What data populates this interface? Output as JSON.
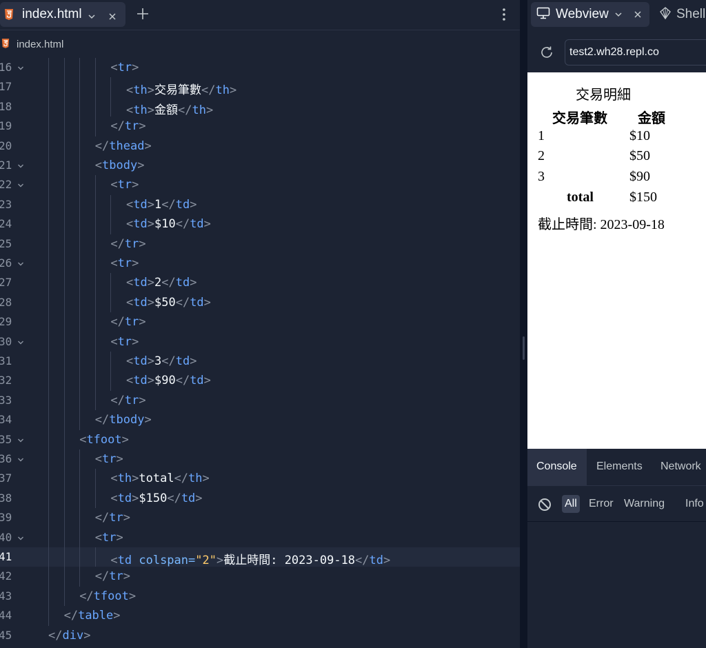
{
  "editor": {
    "tab_label": "index.html",
    "breadcrumb": "index.html",
    "active_line": "41",
    "lines": [
      {
        "n": "16",
        "fold": true,
        "indent": 5,
        "parts": [
          [
            "p",
            "<"
          ],
          [
            "tg",
            "tr"
          ],
          [
            "p",
            ">"
          ]
        ]
      },
      {
        "n": "17",
        "fold": false,
        "indent": 6,
        "parts": [
          [
            "p",
            "<"
          ],
          [
            "tg",
            "th"
          ],
          [
            "p",
            ">"
          ],
          [
            "t",
            "交易筆數"
          ],
          [
            "p",
            "</"
          ],
          [
            "tg",
            "th"
          ],
          [
            "p",
            ">"
          ]
        ]
      },
      {
        "n": "18",
        "fold": false,
        "indent": 6,
        "parts": [
          [
            "p",
            "<"
          ],
          [
            "tg",
            "th"
          ],
          [
            "p",
            ">"
          ],
          [
            "t",
            "金額"
          ],
          [
            "p",
            "</"
          ],
          [
            "tg",
            "th"
          ],
          [
            "p",
            ">"
          ]
        ]
      },
      {
        "n": "19",
        "fold": false,
        "indent": 5,
        "parts": [
          [
            "p",
            "</"
          ],
          [
            "tg",
            "tr"
          ],
          [
            "p",
            ">"
          ]
        ]
      },
      {
        "n": "20",
        "fold": false,
        "indent": 4,
        "parts": [
          [
            "p",
            "</"
          ],
          [
            "tg",
            "thead"
          ],
          [
            "p",
            ">"
          ]
        ]
      },
      {
        "n": "21",
        "fold": true,
        "indent": 4,
        "parts": [
          [
            "p",
            "<"
          ],
          [
            "tg",
            "tbody"
          ],
          [
            "p",
            ">"
          ]
        ]
      },
      {
        "n": "22",
        "fold": true,
        "indent": 5,
        "parts": [
          [
            "p",
            "<"
          ],
          [
            "tg",
            "tr"
          ],
          [
            "p",
            ">"
          ]
        ]
      },
      {
        "n": "23",
        "fold": false,
        "indent": 6,
        "parts": [
          [
            "p",
            "<"
          ],
          [
            "tg",
            "td"
          ],
          [
            "p",
            ">"
          ],
          [
            "t",
            "1"
          ],
          [
            "p",
            "</"
          ],
          [
            "tg",
            "td"
          ],
          [
            "p",
            ">"
          ]
        ]
      },
      {
        "n": "24",
        "fold": false,
        "indent": 6,
        "parts": [
          [
            "p",
            "<"
          ],
          [
            "tg",
            "td"
          ],
          [
            "p",
            ">"
          ],
          [
            "t",
            "$10"
          ],
          [
            "p",
            "</"
          ],
          [
            "tg",
            "td"
          ],
          [
            "p",
            ">"
          ]
        ]
      },
      {
        "n": "25",
        "fold": false,
        "indent": 5,
        "parts": [
          [
            "p",
            "</"
          ],
          [
            "tg",
            "tr"
          ],
          [
            "p",
            ">"
          ]
        ]
      },
      {
        "n": "26",
        "fold": true,
        "indent": 5,
        "parts": [
          [
            "p",
            "<"
          ],
          [
            "tg",
            "tr"
          ],
          [
            "p",
            ">"
          ]
        ]
      },
      {
        "n": "27",
        "fold": false,
        "indent": 6,
        "parts": [
          [
            "p",
            "<"
          ],
          [
            "tg",
            "td"
          ],
          [
            "p",
            ">"
          ],
          [
            "t",
            "2"
          ],
          [
            "p",
            "</"
          ],
          [
            "tg",
            "td"
          ],
          [
            "p",
            ">"
          ]
        ]
      },
      {
        "n": "28",
        "fold": false,
        "indent": 6,
        "parts": [
          [
            "p",
            "<"
          ],
          [
            "tg",
            "td"
          ],
          [
            "p",
            ">"
          ],
          [
            "t",
            "$50"
          ],
          [
            "p",
            "</"
          ],
          [
            "tg",
            "td"
          ],
          [
            "p",
            ">"
          ]
        ]
      },
      {
        "n": "29",
        "fold": false,
        "indent": 5,
        "parts": [
          [
            "p",
            "</"
          ],
          [
            "tg",
            "tr"
          ],
          [
            "p",
            ">"
          ]
        ]
      },
      {
        "n": "30",
        "fold": true,
        "indent": 5,
        "parts": [
          [
            "p",
            "<"
          ],
          [
            "tg",
            "tr"
          ],
          [
            "p",
            ">"
          ]
        ]
      },
      {
        "n": "31",
        "fold": false,
        "indent": 6,
        "parts": [
          [
            "p",
            "<"
          ],
          [
            "tg",
            "td"
          ],
          [
            "p",
            ">"
          ],
          [
            "t",
            "3"
          ],
          [
            "p",
            "</"
          ],
          [
            "tg",
            "td"
          ],
          [
            "p",
            ">"
          ]
        ]
      },
      {
        "n": "32",
        "fold": false,
        "indent": 6,
        "parts": [
          [
            "p",
            "<"
          ],
          [
            "tg",
            "td"
          ],
          [
            "p",
            ">"
          ],
          [
            "t",
            "$90"
          ],
          [
            "p",
            "</"
          ],
          [
            "tg",
            "td"
          ],
          [
            "p",
            ">"
          ]
        ]
      },
      {
        "n": "33",
        "fold": false,
        "indent": 5,
        "parts": [
          [
            "p",
            "</"
          ],
          [
            "tg",
            "tr"
          ],
          [
            "p",
            ">"
          ]
        ]
      },
      {
        "n": "34",
        "fold": false,
        "indent": 4,
        "parts": [
          [
            "p",
            "</"
          ],
          [
            "tg",
            "tbody"
          ],
          [
            "p",
            ">"
          ]
        ]
      },
      {
        "n": "35",
        "fold": true,
        "indent": 3,
        "parts": [
          [
            "p",
            "<"
          ],
          [
            "tg",
            "tfoot"
          ],
          [
            "p",
            ">"
          ]
        ]
      },
      {
        "n": "36",
        "fold": true,
        "indent": 4,
        "parts": [
          [
            "p",
            "<"
          ],
          [
            "tg",
            "tr"
          ],
          [
            "p",
            ">"
          ]
        ]
      },
      {
        "n": "37",
        "fold": false,
        "indent": 5,
        "parts": [
          [
            "p",
            "<"
          ],
          [
            "tg",
            "th"
          ],
          [
            "p",
            ">"
          ],
          [
            "t",
            "total"
          ],
          [
            "p",
            "</"
          ],
          [
            "tg",
            "th"
          ],
          [
            "p",
            ">"
          ]
        ]
      },
      {
        "n": "38",
        "fold": false,
        "indent": 5,
        "parts": [
          [
            "p",
            "<"
          ],
          [
            "tg",
            "td"
          ],
          [
            "p",
            ">"
          ],
          [
            "t",
            "$150"
          ],
          [
            "p",
            "</"
          ],
          [
            "tg",
            "td"
          ],
          [
            "p",
            ">"
          ]
        ]
      },
      {
        "n": "39",
        "fold": false,
        "indent": 4,
        "parts": [
          [
            "p",
            "</"
          ],
          [
            "tg",
            "tr"
          ],
          [
            "p",
            ">"
          ]
        ]
      },
      {
        "n": "40",
        "fold": true,
        "indent": 4,
        "parts": [
          [
            "p",
            "<"
          ],
          [
            "tg",
            "tr"
          ],
          [
            "p",
            ">"
          ]
        ]
      },
      {
        "n": "41",
        "fold": false,
        "indent": 5,
        "parts": [
          [
            "p",
            "<"
          ],
          [
            "tg",
            "td "
          ],
          [
            "at",
            "colspan="
          ],
          [
            "st",
            "\"2\""
          ],
          [
            "p",
            ">"
          ],
          [
            "t",
            "截止時間: 2023-09-18"
          ],
          [
            "p",
            "</"
          ],
          [
            "tg",
            "td"
          ],
          [
            "p",
            ">"
          ]
        ]
      },
      {
        "n": "42",
        "fold": false,
        "indent": 4,
        "parts": [
          [
            "p",
            "</"
          ],
          [
            "tg",
            "tr"
          ],
          [
            "p",
            ">"
          ]
        ]
      },
      {
        "n": "43",
        "fold": false,
        "indent": 3,
        "parts": [
          [
            "p",
            "</"
          ],
          [
            "tg",
            "tfoot"
          ],
          [
            "p",
            ">"
          ]
        ]
      },
      {
        "n": "44",
        "fold": false,
        "indent": 2,
        "parts": [
          [
            "p",
            "</"
          ],
          [
            "tg",
            "table"
          ],
          [
            "p",
            ">"
          ]
        ]
      },
      {
        "n": "45",
        "fold": false,
        "indent": 1,
        "parts": [
          [
            "p",
            "</"
          ],
          [
            "tg",
            "div"
          ],
          [
            "p",
            ">"
          ]
        ]
      }
    ]
  },
  "webview": {
    "tab_label": "Webview",
    "shell_label": "Shell",
    "url": "test2.wh28.repl.co",
    "page": {
      "caption": "交易明細",
      "headers": [
        "交易筆數",
        "金額"
      ],
      "rows": [
        [
          "1",
          "$10"
        ],
        [
          "2",
          "$50"
        ],
        [
          "3",
          "$90"
        ]
      ],
      "total_label": "total",
      "total_value": "$150",
      "footer": "截止時間: 2023-09-18"
    }
  },
  "devtools": {
    "tabs": [
      "Console",
      "Elements",
      "Network"
    ],
    "filters": [
      "All",
      "Error",
      "Warning",
      "Info"
    ]
  },
  "colors": {
    "background": "#1c2333",
    "tag": "#6aa7ff",
    "string": "#ffcb6b",
    "html_icon": "#e36f34"
  }
}
